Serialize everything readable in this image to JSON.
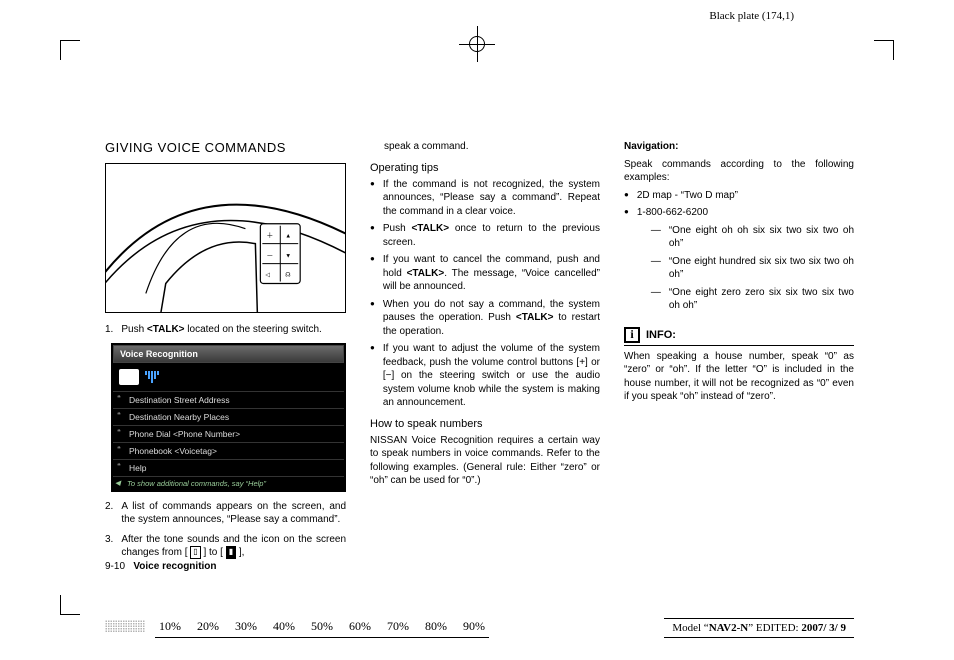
{
  "plate_label": "Black plate (174,1)",
  "col1": {
    "section_title": "GIVING VOICE COMMANDS",
    "steps": [
      {
        "n": "1.",
        "text_pre": "Push ",
        "bold": "<TALK>",
        "text_post": " located on the steering switch."
      },
      {
        "n": "2.",
        "text": "A list of commands appears on the screen, and the system announces, “Please say a command”."
      },
      {
        "n": "3.",
        "text": "After the tone sounds and the icon on the screen changes from [   ] to [   ],"
      }
    ],
    "vr_title": "Voice Recognition",
    "vr_items": [
      "Destination Street Address",
      "Destination Nearby Places",
      "Phone Dial <Phone Number>",
      "Phonebook <Voicetag>",
      "Help"
    ],
    "vr_foot": "To show additional commands, say “Help”"
  },
  "col2": {
    "lead": "speak a command.",
    "sub1": "Operating tips",
    "bullets1": [
      {
        "text": "If the command is not recognized, the system announces, “Please say a com­mand”.\nRepeat the command in a clear voice."
      },
      {
        "pre": "Push ",
        "bold": "<TALK>",
        "post": " once to return to the previous screen."
      },
      {
        "pre": "If you want to cancel the command, push and hold ",
        "bold": "<TALK>",
        "post": ". The message, “Voice cancelled” will be announced."
      },
      {
        "pre": "When you do not say a command, the system pauses the operation. Push ",
        "bold": "<TALK>",
        "post": " to restart the operation."
      },
      {
        "text": "If you want to adjust the volume of the system feedback, push the volume control buttons [+] or [−] on the steering switch or use the audio system volume knob while the system is making an announcement."
      }
    ],
    "sub2": "How to speak numbers",
    "para2": "NISSAN Voice Recognition requires a certain way to speak numbers in voice commands. Refer to the following examples. (General rule: Either “zero” or “oh” can be used for “0”.)"
  },
  "col3": {
    "nav_label": "Navigation:",
    "nav_para": "Speak commands according to the following examples:",
    "nav_bullets": [
      "2D map - “Two D map”",
      "1-800-662-6200"
    ],
    "nav_sub": [
      "“One eight oh oh six six two six two oh oh”",
      "“One eight hundred six six two six two oh oh”",
      "“One eight zero zero six six two six two oh oh”"
    ],
    "info_label": "INFO:",
    "info_text": "When speaking a house number, speak “0” as “zero” or “oh”. If the letter “O” is included in the house number, it will not be recognized as “0” even if you speak “oh” instead of “zero”."
  },
  "footer": {
    "page_num": "9-10",
    "page_label": "Voice recognition",
    "percents": [
      "10%",
      "20%",
      "30%",
      "40%",
      "50%",
      "60%",
      "70%",
      "80%",
      "90%"
    ],
    "model_pre": "Model “",
    "model_bold": "NAV2-N",
    "model_mid": "”  EDITED: ",
    "model_date": "2007/ 3/ 9"
  }
}
